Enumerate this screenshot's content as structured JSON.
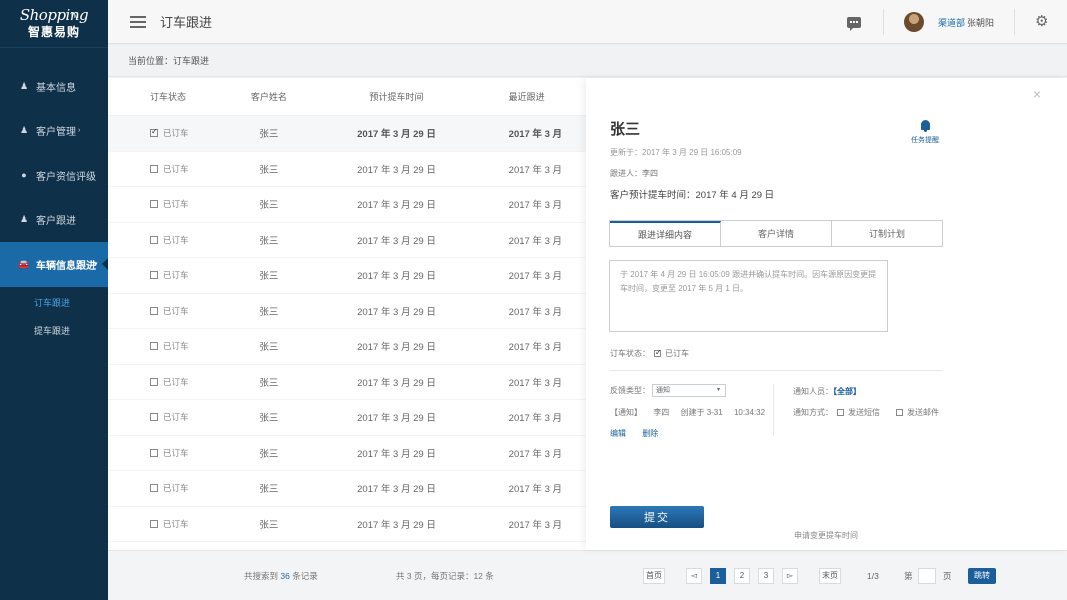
{
  "brand": {
    "logo_main": "Shopping",
    "logo_sub": "智惠易购",
    "tm": "TM"
  },
  "sidebar": {
    "items": [
      {
        "label": "基本信息",
        "icon": "user-icon"
      },
      {
        "label": "客户管理",
        "icon": "user-icon",
        "caret": "›"
      },
      {
        "label": "客户资信评级",
        "icon": "dot-icon"
      },
      {
        "label": "客户跟进",
        "icon": "user-icon"
      },
      {
        "label": "车辆信息跟进",
        "icon": "car-icon",
        "caret": "▾"
      }
    ],
    "subitems": [
      {
        "label": "订车跟进"
      },
      {
        "label": "提车跟进"
      }
    ]
  },
  "header": {
    "title": "订车跟进",
    "user_dept": "渠道部",
    "user_name": "张朝阳"
  },
  "breadcrumb": "当前位置：订车跟进",
  "table": {
    "headers": [
      "订车状态",
      "客户姓名",
      "预计提车时间",
      "最近跟进"
    ],
    "rows": [
      {
        "status": "已订车",
        "name": "张三",
        "date": "2017 年 3 月 29 日",
        "recent": "2017 年 3 月"
      },
      {
        "status": "已订车",
        "name": "张三",
        "date": "2017 年 3 月 29 日",
        "recent": "2017 年 3 月"
      },
      {
        "status": "已订车",
        "name": "张三",
        "date": "2017 年 3 月 29 日",
        "recent": "2017 年 3 月"
      },
      {
        "status": "已订车",
        "name": "张三",
        "date": "2017 年 3 月 29 日",
        "recent": "2017 年 3 月"
      },
      {
        "status": "已订车",
        "name": "张三",
        "date": "2017 年 3 月 29 日",
        "recent": "2017 年 3 月"
      },
      {
        "status": "已订车",
        "name": "张三",
        "date": "2017 年 3 月 29 日",
        "recent": "2017 年 3 月"
      },
      {
        "status": "已订车",
        "name": "张三",
        "date": "2017 年 3 月 29 日",
        "recent": "2017 年 3 月"
      },
      {
        "status": "已订车",
        "name": "张三",
        "date": "2017 年 3 月 29 日",
        "recent": "2017 年 3 月"
      },
      {
        "status": "已订车",
        "name": "张三",
        "date": "2017 年 3 月 29 日",
        "recent": "2017 年 3 月"
      },
      {
        "status": "已订车",
        "name": "张三",
        "date": "2017 年 3 月 29 日",
        "recent": "2017 年 3 月"
      },
      {
        "status": "已订车",
        "name": "张三",
        "date": "2017 年 3 月 29 日",
        "recent": "2017 年 3 月"
      },
      {
        "status": "已订车",
        "name": "张三",
        "date": "2017 年 3 月 29 日",
        "recent": "2017 年 3 月"
      }
    ]
  },
  "footer": {
    "total_prefix": "共搜索到",
    "total_count": "36",
    "total_suffix": "条记录",
    "pages_info": "共 3 页，每页记录：12 条",
    "first": "首页",
    "prev": "◅",
    "pages": [
      "1",
      "2",
      "3"
    ],
    "next": "▻",
    "last": "末页",
    "page_of": "1/3",
    "jump_prefix": "第",
    "jump_suffix": "页",
    "jump": "跳转"
  },
  "panel": {
    "close": "×",
    "name": "张三",
    "updated": "更新于：2017 年 3 月 29 日 16:05:09",
    "follower": "跟进人：李四",
    "expected": "客户预计提车时间：2017 年 4 月 29 日",
    "reminder": "任务提醒",
    "tabs": [
      "跟进详细内容",
      "客户详情",
      "订制计划"
    ],
    "detail_text": "于 2017 年 4 月 29 日 16:05:09 跟进并确认提车时间。因车源原因变更提车时间，变更至 2017 年 5 月 1 日。",
    "status_label": "订车状态：",
    "status_value": "已订车",
    "feedback_label": "反馈类型：",
    "feedback_value": "通知",
    "notice": {
      "tag": "【通知】",
      "person": "李四",
      "created": "创建于 3-31",
      "time": "10:34:32"
    },
    "edit": "编辑",
    "delete": "删除",
    "notify_label": "通知人员：",
    "notify_all": "【全部】",
    "notify_mode_label": "通知方式：",
    "sms": "发送短信",
    "email": "发送邮件",
    "submit": "提交",
    "apply_change": "申请变更提车时间"
  },
  "colors": {
    "sidebar_bg": "#0f3049",
    "accent": "#1a5f9a",
    "active_nav": "#1a6aa8"
  }
}
